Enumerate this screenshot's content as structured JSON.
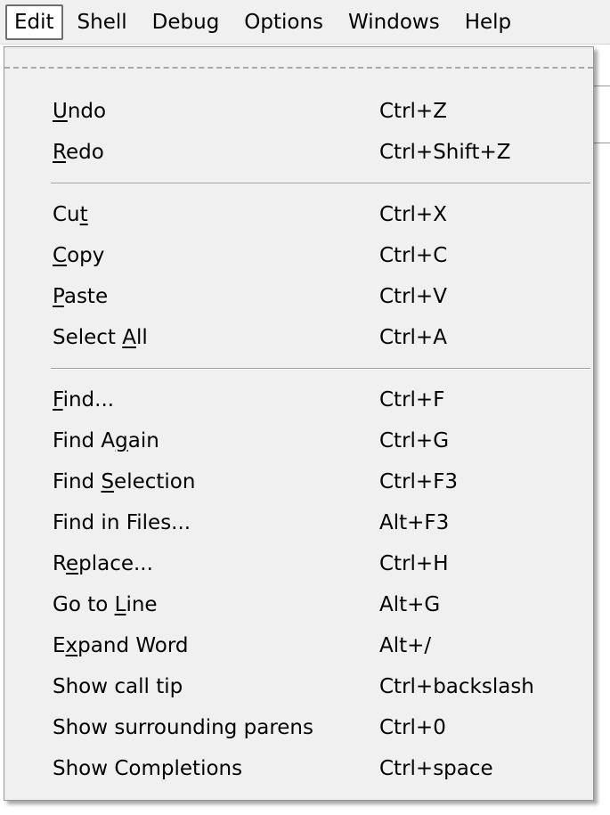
{
  "menubar": {
    "items": [
      "Edit",
      "Shell",
      "Debug",
      "Options",
      "Windows",
      "Help"
    ],
    "active": "Edit"
  },
  "edit_menu": {
    "groups": [
      [
        {
          "label": "Undo",
          "mnemonic_index": 0,
          "accel": "Ctrl+Z"
        },
        {
          "label": "Redo",
          "mnemonic_index": 0,
          "accel": "Ctrl+Shift+Z"
        }
      ],
      [
        {
          "label": "Cut",
          "mnemonic_index": 2,
          "accel": "Ctrl+X"
        },
        {
          "label": "Copy",
          "mnemonic_index": 0,
          "accel": "Ctrl+C"
        },
        {
          "label": "Paste",
          "mnemonic_index": 0,
          "accel": "Ctrl+V"
        },
        {
          "label": "Select All",
          "mnemonic_index": 7,
          "accel": "Ctrl+A"
        }
      ],
      [
        {
          "label": "Find...",
          "mnemonic_index": 0,
          "accel": "Ctrl+F"
        },
        {
          "label": "Find Again",
          "mnemonic_index": 6,
          "accel": "Ctrl+G"
        },
        {
          "label": "Find Selection",
          "mnemonic_index": 5,
          "accel": "Ctrl+F3"
        },
        {
          "label": "Find in Files...",
          "mnemonic_index": -1,
          "accel": "Alt+F3"
        },
        {
          "label": "Replace...",
          "mnemonic_index": 1,
          "accel": "Ctrl+H"
        },
        {
          "label": "Go to Line",
          "mnemonic_index": 6,
          "accel": "Alt+G"
        },
        {
          "label": "Expand Word",
          "mnemonic_index": 1,
          "accel": "Alt+/"
        },
        {
          "label": "Show call tip",
          "mnemonic_index": -1,
          "accel": "Ctrl+backslash"
        },
        {
          "label": "Show surrounding parens",
          "mnemonic_index": -1,
          "accel": "Ctrl+0"
        },
        {
          "label": "Show Completions",
          "mnemonic_index": -1,
          "accel": "Ctrl+space"
        }
      ]
    ]
  },
  "colors": {
    "menu_bg": "#f0f0f0",
    "separator": "#a0a0a0",
    "border": "#979797"
  }
}
